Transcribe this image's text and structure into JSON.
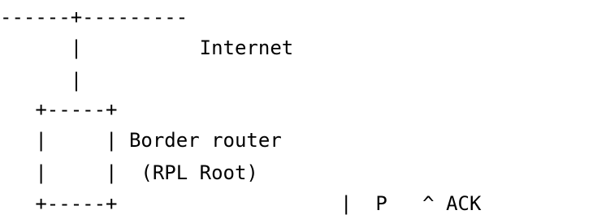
{
  "diagram": {
    "lines": [
      "------+---------",
      "      |          Internet",
      "      |",
      "   +-----+",
      "   |     | Border router",
      "   |     |  (RPL Root)",
      "   +-----+                   |  P   ^ ACK"
    ]
  }
}
